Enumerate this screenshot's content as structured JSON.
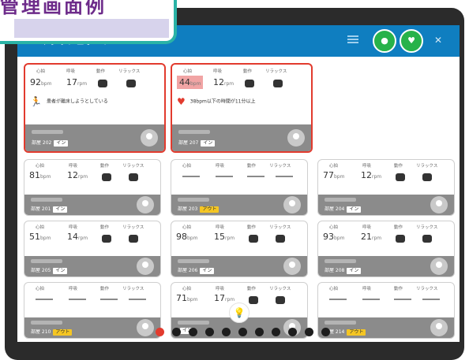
{
  "overlay_title": "管理画面例",
  "appbar": {
    "menu_icon": "menu-icon",
    "title": "/ ダッシュボード",
    "btn1_icon": "person-icon",
    "btn2_icon": "heart-monitor-icon",
    "mute_icon": "mute-icon"
  },
  "labels": {
    "hr": "心拍",
    "resp": "呼吸",
    "motion": "動作",
    "relax": "リラックス"
  },
  "units": {
    "bpm": "bpm",
    "rpm": "rpm"
  },
  "alerts": [
    {
      "hr": "92",
      "rr": "17",
      "message": "患者が離床しようとしている",
      "room": "部屋 202",
      "status": "イン"
    },
    {
      "hr": "44",
      "rr": "12",
      "message": "38bpm以下の時間が11分以上",
      "room": "部屋 207",
      "status": "イン"
    }
  ],
  "cards": [
    {
      "hr": "81",
      "rr": "12",
      "room": "部屋 201",
      "status": "イン"
    },
    {
      "hr": "",
      "rr": "",
      "room": "部屋 203",
      "status": "アウト"
    },
    {
      "hr": "77",
      "rr": "12",
      "room": "部屋 204",
      "status": "イン"
    },
    {
      "hr": "51",
      "rr": "14",
      "room": "部屋 205",
      "status": "イン"
    },
    {
      "hr": "98",
      "rr": "15",
      "room": "部屋 206",
      "status": "イン"
    },
    {
      "hr": "93",
      "rr": "21",
      "room": "部屋 208",
      "status": "イン"
    },
    {
      "hr": "",
      "rr": "",
      "room": "部屋 210",
      "status": "アウト"
    },
    {
      "hr": "71",
      "rr": "17",
      "room": "",
      "status": "イン"
    },
    {
      "hr": "",
      "rr": "",
      "room": "部屋 214",
      "status": "アウト"
    }
  ],
  "colors": {
    "appbar": "#0f7ec0",
    "alert_border": "#e23b2e",
    "in_badge": "#ffffff",
    "out_badge": "#f5c623",
    "green_button": "#27b24a",
    "badge_border": "#2ab3a6",
    "overlay_text": "#6d2b8a"
  },
  "pager": {
    "count": 11,
    "active_index": 0
  }
}
